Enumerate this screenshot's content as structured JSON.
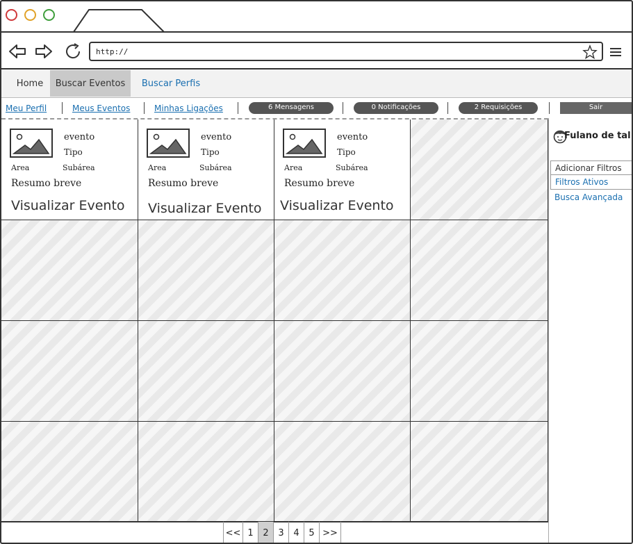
{
  "browser": {
    "url": "http://"
  },
  "tabs": [
    {
      "label": "Home"
    },
    {
      "label": "Buscar Eventos"
    },
    {
      "label": "Buscar Perfis"
    }
  ],
  "links": {
    "meu_perfil": "Meu Perfil",
    "meus_eventos": "Meus Eventos",
    "minhas_ligacoes": "Minhas Ligações",
    "mensagens": "6 Mensagens",
    "notificacoes": "0 Notificações",
    "requisicoes": "2 Requisições",
    "sair": "Sair"
  },
  "cards": [
    {
      "evento": "evento",
      "tipo": "Tipo",
      "area": "Area",
      "subarea": "Subárea",
      "resumo": "Resumo breve",
      "view": "Visualizar Evento"
    },
    {
      "evento": "evento",
      "tipo": "Tipo",
      "area": "Area",
      "subarea": "Subárea",
      "resumo": "Resumo breve",
      "view": "Visualizar Evento"
    },
    {
      "evento": "evento",
      "tipo": "Tipo",
      "area": "Area",
      "subarea": "Subárea",
      "resumo": "Resumo breve",
      "view": "Visualizar Evento"
    }
  ],
  "pagination": {
    "prev": "<<",
    "pages": [
      "1",
      "2",
      "3",
      "4",
      "5"
    ],
    "active": "2",
    "next": ">>"
  },
  "sidebar": {
    "user": "Fulano de tal",
    "items": [
      "Adicionar Filtros",
      "Filtros Ativos",
      "Busca Avançada"
    ]
  }
}
